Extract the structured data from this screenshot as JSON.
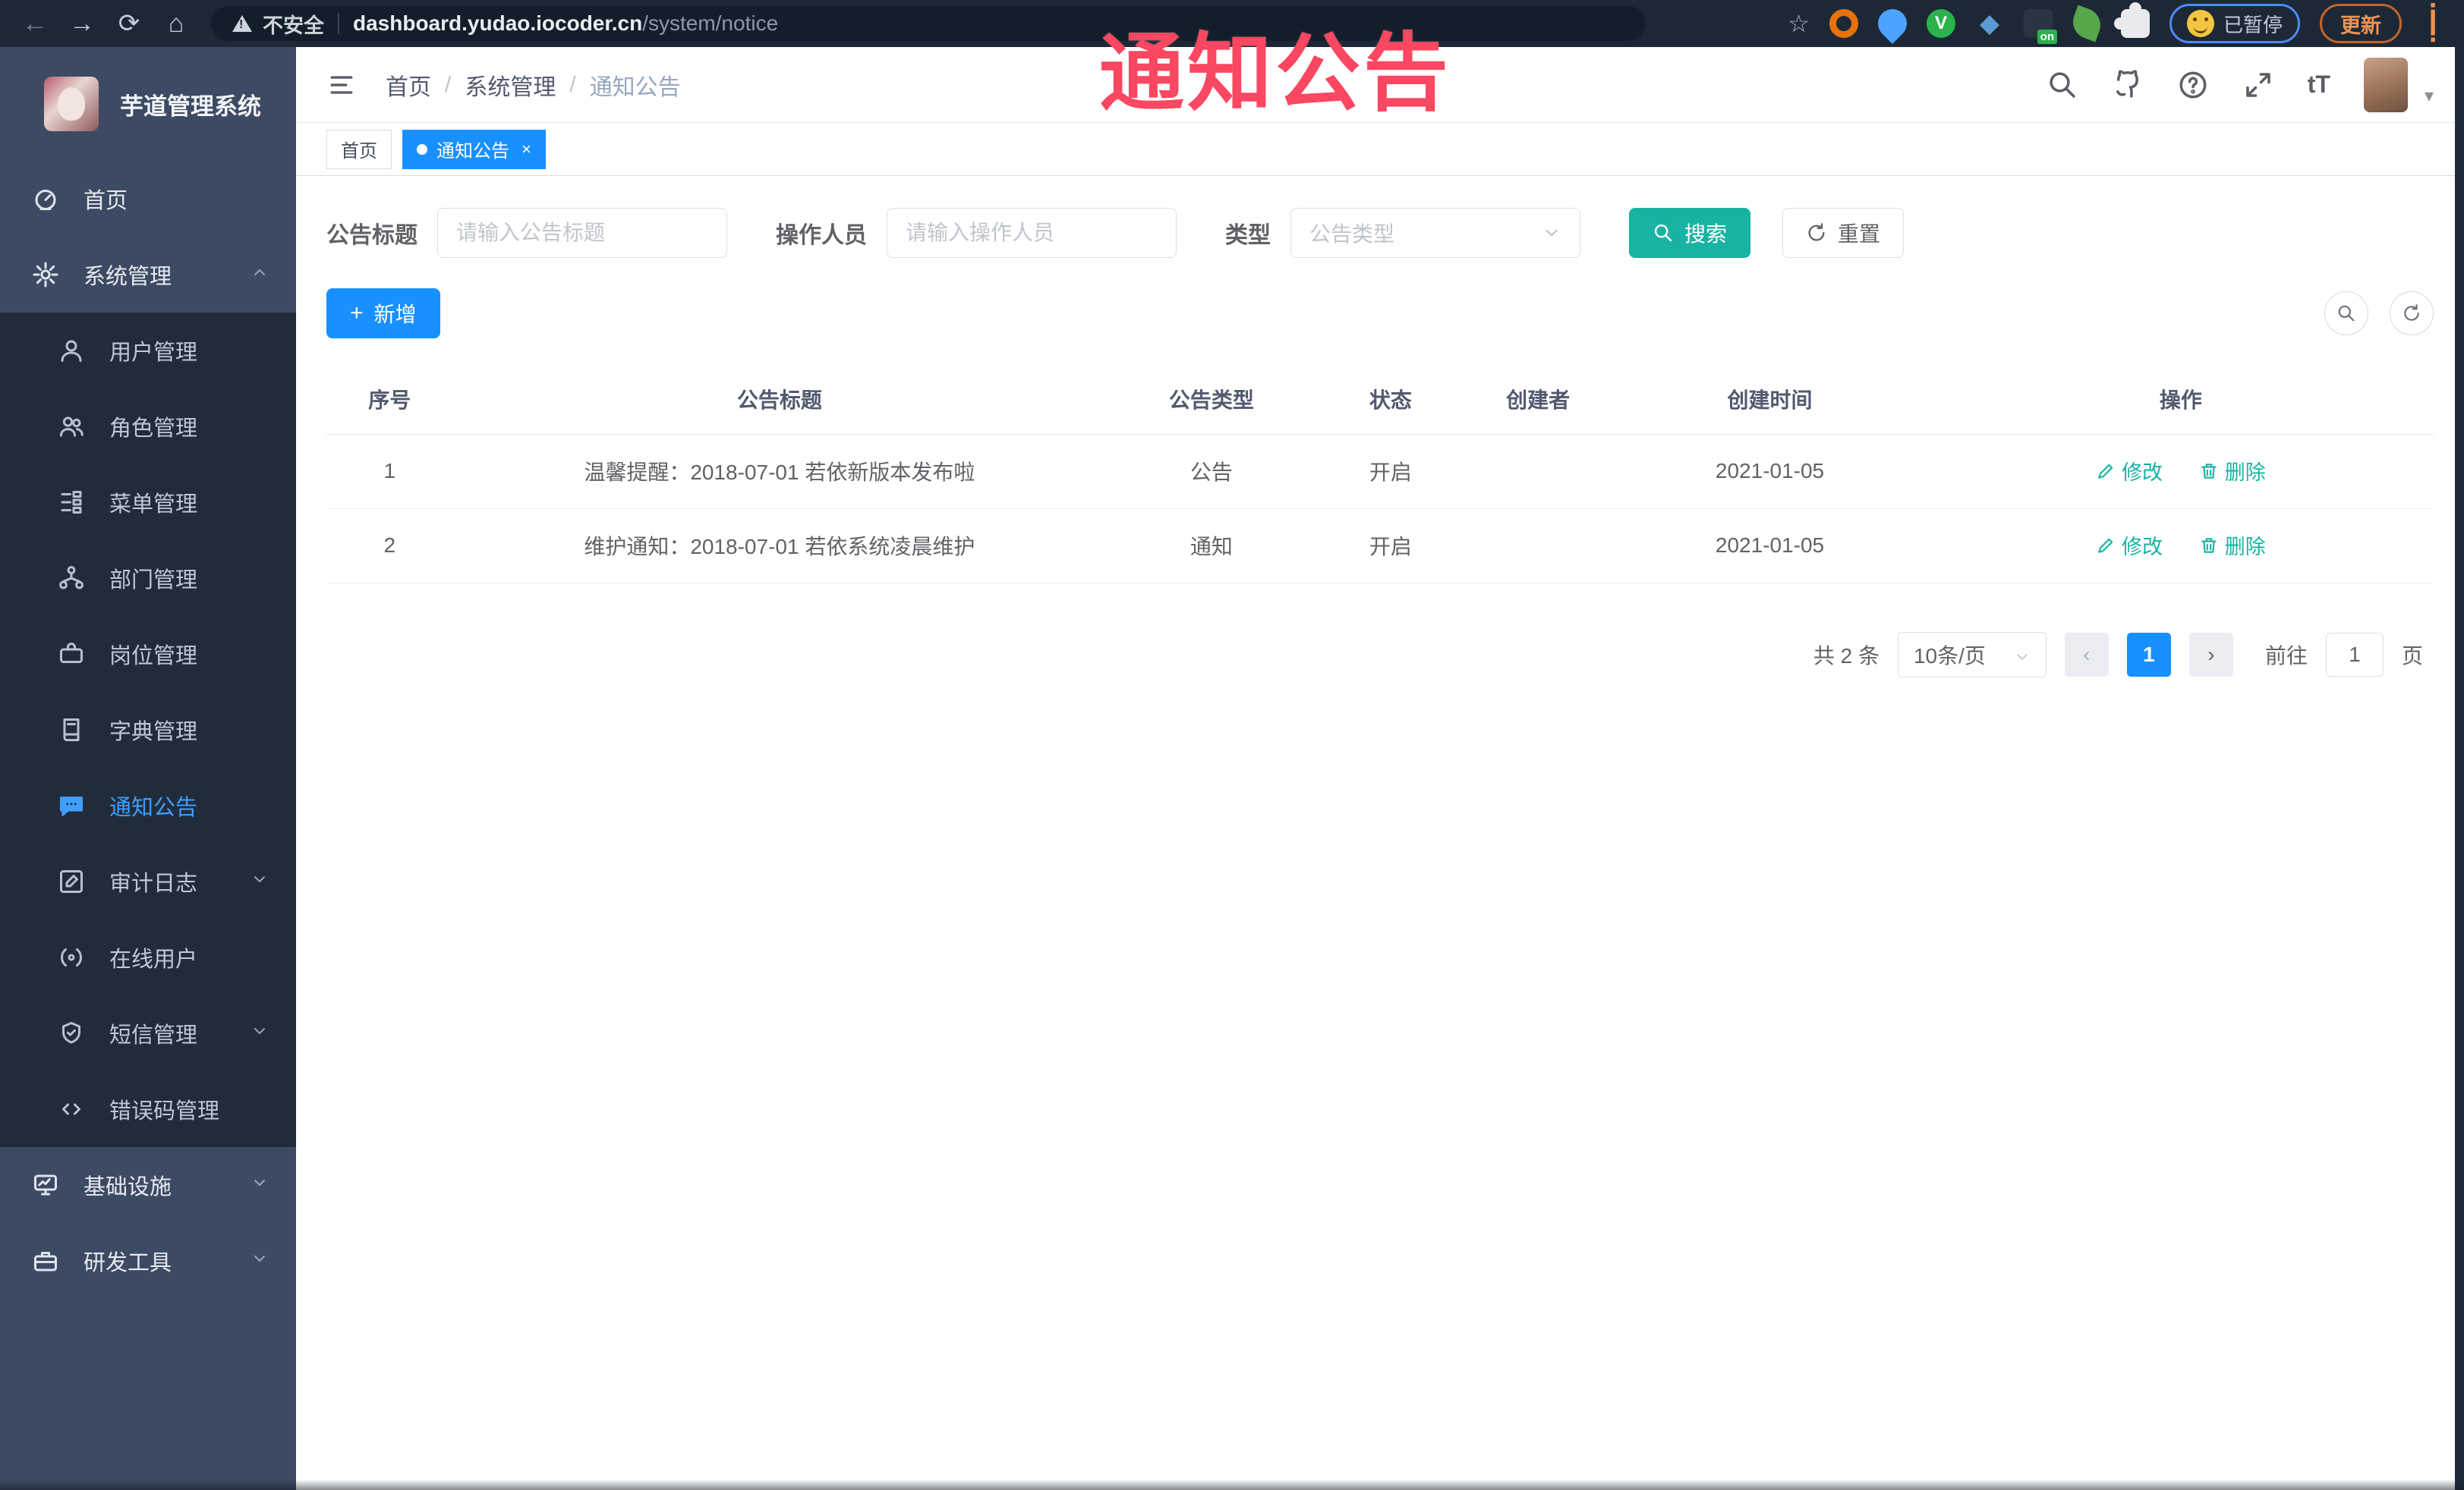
{
  "browser": {
    "security_label": "不安全",
    "url_host": "dashboard.yudao.iocoder.cn",
    "url_path": "/system/notice",
    "paused_badge": "已暂停",
    "update_button": "更新"
  },
  "overlay": {
    "text": "通知公告",
    "color": "#fb4761"
  },
  "sidebar": {
    "title": "芋道管理系统",
    "home": "首页",
    "system": "系统管理",
    "submenu": [
      "用户管理",
      "角色管理",
      "菜单管理",
      "部门管理",
      "岗位管理",
      "字典管理",
      "通知公告",
      "审计日志",
      "在线用户",
      "短信管理",
      "错误码管理"
    ],
    "active_item": "通知公告",
    "infra": "基础设施",
    "devtool": "研发工具"
  },
  "navbar": {
    "breadcrumb": [
      "首页",
      "系统管理",
      "通知公告"
    ]
  },
  "tabs": [
    {
      "label": "首页"
    },
    {
      "label": "通知公告"
    }
  ],
  "filter": {
    "title_label": "公告标题",
    "title_placeholder": "请输入公告标题",
    "operator_label": "操作人员",
    "operator_placeholder": "请输入操作人员",
    "type_label": "类型",
    "type_placeholder": "公告类型",
    "search": "搜索",
    "reset": "重置"
  },
  "toolbar": {
    "add": "新增"
  },
  "table": {
    "columns": [
      "序号",
      "公告标题",
      "公告类型",
      "状态",
      "创建者",
      "创建时间",
      "操作"
    ],
    "edit_label": "修改",
    "delete_label": "删除",
    "rows": [
      {
        "no": "1",
        "title": "温馨提醒：2018-07-01 若依新版本发布啦",
        "type": "公告",
        "status": "开启",
        "creator": "",
        "time": "2021-01-05"
      },
      {
        "no": "2",
        "title": "维护通知：2018-07-01 若依系统凌晨维护",
        "type": "通知",
        "status": "开启",
        "creator": "",
        "time": "2021-01-05"
      }
    ]
  },
  "pagination": {
    "total": "共 2 条",
    "page_size": "10条/页",
    "prev": "‹",
    "next": "›",
    "current": "1",
    "goto_label": "前往",
    "goto_value": "1",
    "page_unit": "页"
  },
  "colors": {
    "accent_blue": "#1890ff",
    "teal": "#18b3a3",
    "sidebar": "#3d4a63",
    "submenu": "#212c3b"
  }
}
